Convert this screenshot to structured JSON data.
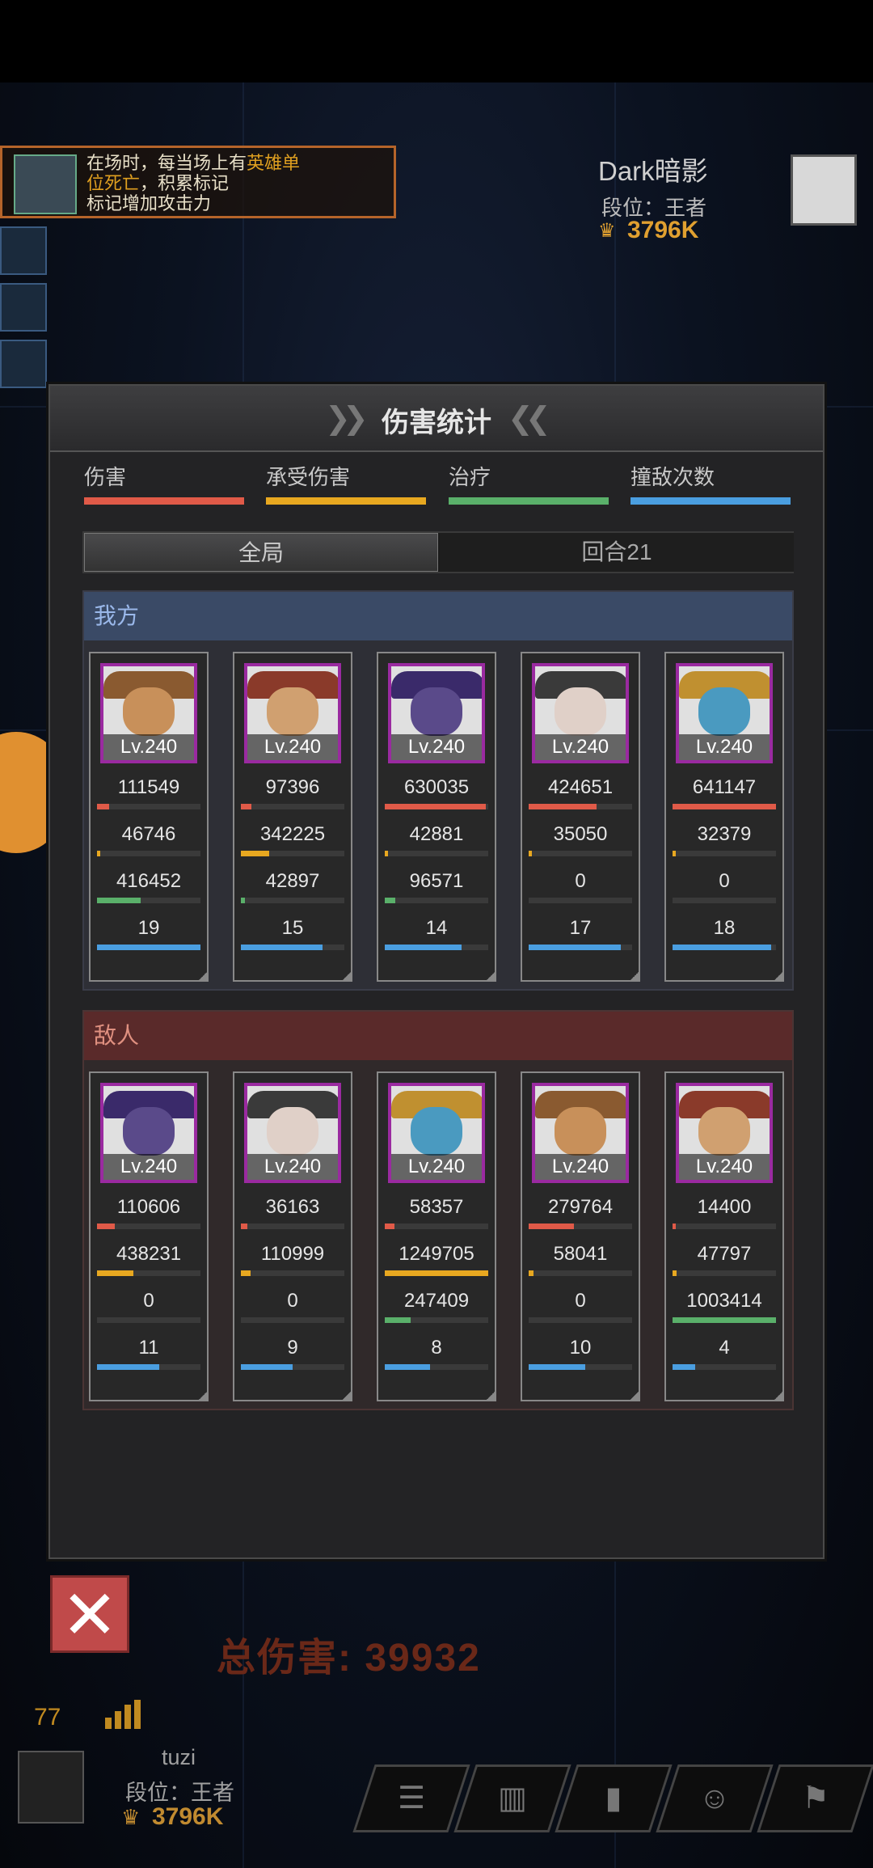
{
  "scene": {
    "skill_text_parts": [
      "在场时，每当场上有",
      "英雄单位死亡",
      "，积累标记",
      "标记增加攻击力"
    ],
    "opponent": {
      "name": "Dark暗影",
      "rank": "段位：王者",
      "power": "3796K"
    },
    "total_damage_label": "总伤害:",
    "total_damage_value": "39932",
    "ping": "77",
    "player": {
      "name": "tuzi",
      "rank": "段位：王者",
      "power": "3796K"
    }
  },
  "modal": {
    "title": "伤害统计",
    "legend": [
      {
        "label": "伤害",
        "color": "#e05a48"
      },
      {
        "label": "承受伤害",
        "color": "#e8a820"
      },
      {
        "label": "治疗",
        "color": "#5ab06a"
      },
      {
        "label": "撞敌次数",
        "color": "#4a9ee0"
      }
    ],
    "tabs": {
      "global": "全局",
      "round": "回合21"
    },
    "ally": {
      "header": "我方",
      "heroes": [
        {
          "level": "Lv.240",
          "damage": "111549",
          "taken": "46746",
          "heal": "416452",
          "hits": "19",
          "fill": [
            0.12,
            0.03,
            0.42,
            1.0
          ]
        },
        {
          "level": "Lv.240",
          "damage": "97396",
          "taken": "342225",
          "heal": "42897",
          "hits": "15",
          "fill": [
            0.1,
            0.27,
            0.04,
            0.79
          ]
        },
        {
          "level": "Lv.240",
          "damage": "630035",
          "taken": "42881",
          "heal": "96571",
          "hits": "14",
          "fill": [
            0.98,
            0.03,
            0.1,
            0.74
          ]
        },
        {
          "level": "Lv.240",
          "damage": "424651",
          "taken": "35050",
          "heal": "0",
          "hits": "17",
          "fill": [
            0.66,
            0.03,
            0.0,
            0.89
          ]
        },
        {
          "level": "Lv.240",
          "damage": "641147",
          "taken": "32379",
          "heal": "0",
          "hits": "18",
          "fill": [
            1.0,
            0.03,
            0.0,
            0.95
          ]
        }
      ]
    },
    "enemy": {
      "header": "敌人",
      "heroes": [
        {
          "level": "Lv.240",
          "damage": "110606",
          "taken": "438231",
          "heal": "0",
          "hits": "11",
          "fill": [
            0.17,
            0.35,
            0.0,
            0.6
          ]
        },
        {
          "level": "Lv.240",
          "damage": "36163",
          "taken": "110999",
          "heal": "0",
          "hits": "9",
          "fill": [
            0.06,
            0.09,
            0.0,
            0.5
          ]
        },
        {
          "level": "Lv.240",
          "damage": "58357",
          "taken": "1249705",
          "heal": "247409",
          "hits": "8",
          "fill": [
            0.09,
            1.0,
            0.25,
            0.44
          ]
        },
        {
          "level": "Lv.240",
          "damage": "279764",
          "taken": "58041",
          "heal": "0",
          "hits": "10",
          "fill": [
            0.44,
            0.05,
            0.0,
            0.55
          ]
        },
        {
          "level": "Lv.240",
          "damage": "14400",
          "taken": "47797",
          "heal": "1003414",
          "hits": "4",
          "fill": [
            0.03,
            0.04,
            1.0,
            0.22
          ]
        }
      ]
    }
  }
}
